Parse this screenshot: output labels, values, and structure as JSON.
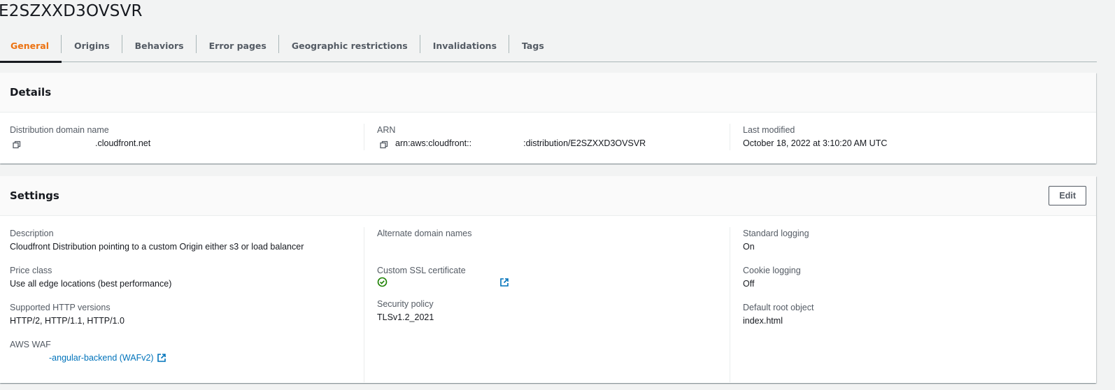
{
  "page": {
    "title": "E2SZXXD3OVSVR"
  },
  "tabs": [
    {
      "label": "General",
      "active": true
    },
    {
      "label": "Origins"
    },
    {
      "label": "Behaviors"
    },
    {
      "label": "Error pages"
    },
    {
      "label": "Geographic restrictions"
    },
    {
      "label": "Invalidations"
    },
    {
      "label": "Tags"
    }
  ],
  "details": {
    "title": "Details",
    "domain": {
      "label": "Distribution domain name",
      "value": ".cloudfront.net",
      "icon": "copy-icon"
    },
    "arn": {
      "label": "ARN",
      "prefix": "arn:aws:cloudfront::",
      "suffix": ":distribution/E2SZXXD3OVSVR",
      "icon": "copy-icon"
    },
    "modified": {
      "label": "Last modified",
      "value": "October 18, 2022 at 3:10:20 AM UTC"
    }
  },
  "settings": {
    "title": "Settings",
    "edit_label": "Edit",
    "description": {
      "label": "Description",
      "value": "Cloudfront Distribution pointing to a custom Origin either s3 or load balancer"
    },
    "price_class": {
      "label": "Price class",
      "value": "Use all edge locations (best performance)"
    },
    "http_versions": {
      "label": "Supported HTTP versions",
      "value": "HTTP/2, HTTP/1.1, HTTP/1.0"
    },
    "waf": {
      "label": "AWS WAF",
      "value": "-angular-backend (WAFv2)",
      "icon": "external-link-icon"
    },
    "alt_domains": {
      "label": "Alternate domain names",
      "value": ""
    },
    "ssl_cert": {
      "label": "Custom SSL certificate",
      "icon": "check-circle-icon",
      "link_icon": "external-link-icon"
    },
    "security_policy": {
      "label": "Security policy",
      "value": "TLSv1.2_2021"
    },
    "std_logging": {
      "label": "Standard logging",
      "value": "On"
    },
    "cookie_logging": {
      "label": "Cookie logging",
      "value": "Off"
    },
    "root_object": {
      "label": "Default root object",
      "value": "index.html"
    }
  },
  "colors": {
    "accent": "#ec7211",
    "link": "#0073bb",
    "success": "#1d8102"
  }
}
